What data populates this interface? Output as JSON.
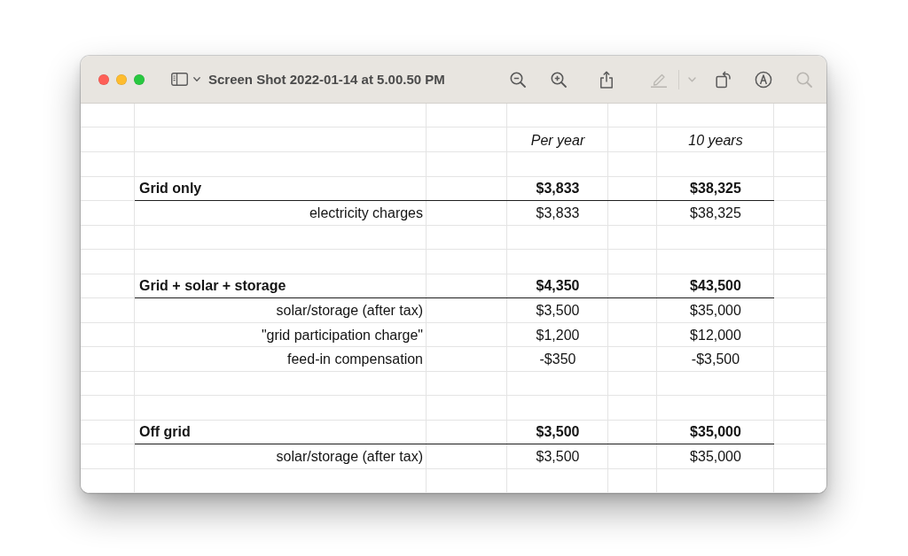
{
  "window": {
    "title": "Screen Shot 2022-01-14 at 5.00.50 PM"
  },
  "toolbar": [
    {
      "kind": "zoomout",
      "disabled": false
    },
    {
      "kind": "zoomin",
      "disabled": false
    },
    {
      "kind": "share",
      "disabled": false
    },
    {
      "kind": "highlight",
      "disabled": true
    },
    {
      "kind": "menu",
      "disabled": true
    },
    {
      "kind": "rotate",
      "disabled": false
    },
    {
      "kind": "markup",
      "disabled": false
    },
    {
      "kind": "search",
      "disabled": true
    }
  ],
  "sheet": {
    "columns": [
      "Per year",
      "10 years"
    ],
    "sections": [
      {
        "label": "Grid only",
        "values": [
          "$3,833",
          "$38,325"
        ],
        "items": [
          {
            "label": "electricity charges",
            "values": [
              "$3,833",
              "$38,325"
            ]
          }
        ]
      },
      {
        "label": "Grid + solar + storage",
        "values": [
          "$4,350",
          "$43,500"
        ],
        "items": [
          {
            "label": "solar/storage (after tax)",
            "values": [
              "$3,500",
              "$35,000"
            ]
          },
          {
            "label": "\"grid participation charge\"",
            "values": [
              "$1,200",
              "$12,000"
            ]
          },
          {
            "label": "feed-in compensation",
            "values": [
              "-$350",
              "-$3,500"
            ]
          }
        ]
      },
      {
        "label": "Off grid",
        "values": [
          "$3,500",
          "$35,000"
        ],
        "items": [
          {
            "label": "solar/storage (after tax)",
            "values": [
              "$3,500",
              "$35,000"
            ]
          }
        ]
      }
    ]
  }
}
